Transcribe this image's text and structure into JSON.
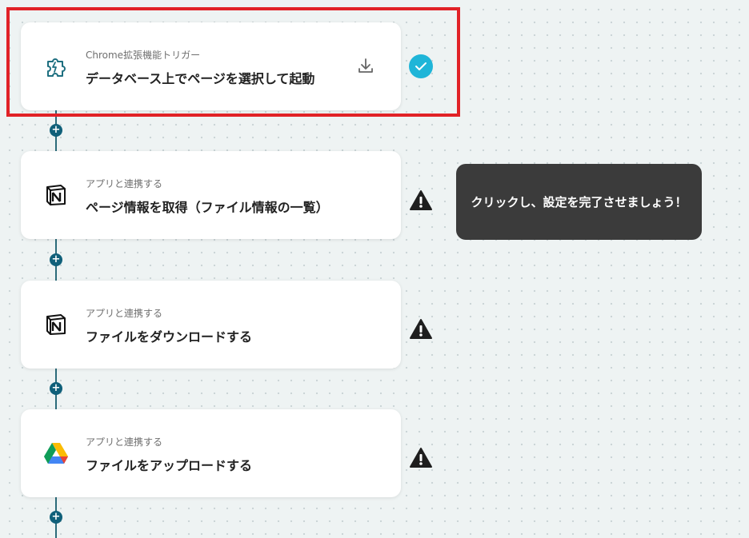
{
  "colors": {
    "accent": "#10607a",
    "check": "#1fb5d8",
    "highlight": "#e12227",
    "tooltip_bg": "#3b3b3b"
  },
  "steps": [
    {
      "subtitle": "Chrome拡張機能トリガー",
      "title": "データベース上でページを選択して起動",
      "icon": "chrome-extension-puzzle-icon",
      "status": "completed"
    },
    {
      "subtitle": "アプリと連携する",
      "title": "ページ情報を取得（ファイル情報の一覧）",
      "icon": "notion-icon",
      "status": "warning"
    },
    {
      "subtitle": "アプリと連携する",
      "title": "ファイルをダウンロードする",
      "icon": "notion-icon",
      "status": "warning"
    },
    {
      "subtitle": "アプリと連携する",
      "title": "ファイルをアップロードする",
      "icon": "google-drive-icon",
      "status": "warning"
    }
  ],
  "add_step_symbol": "+",
  "tooltip": {
    "text": "クリックし、設定を完了させましょう！"
  }
}
